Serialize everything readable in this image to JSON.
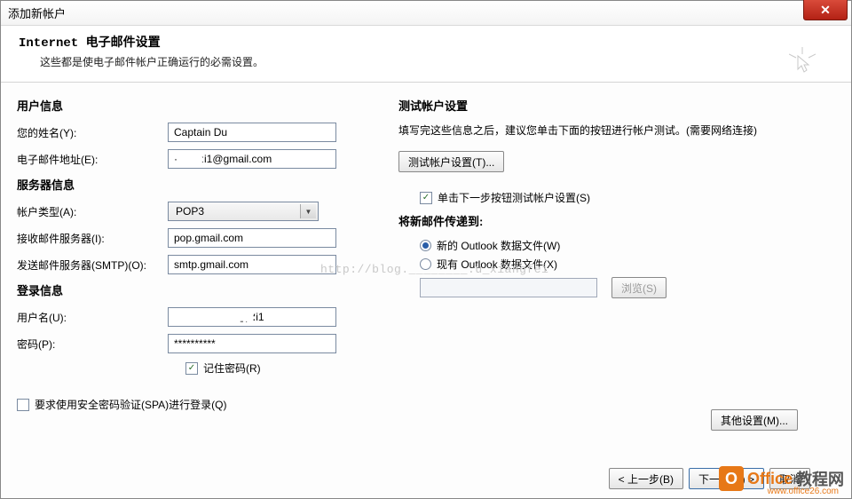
{
  "window": {
    "title": "添加新帐户"
  },
  "header": {
    "title": "Internet 电子邮件设置",
    "description": "这些都是使电子邮件帐户正确运行的必需设置。"
  },
  "left": {
    "user_info_title": "用户信息",
    "name_label": "您的姓名(Y):",
    "name_value": "Captain Du",
    "email_label": "电子邮件地址(E):",
    "email_value": "·        ːi1@gmail.com",
    "server_info_title": "服务器信息",
    "account_type_label": "帐户类型(A):",
    "account_type_value": "POP3",
    "incoming_label": "接收邮件服务器(I):",
    "incoming_value": "pop.gmail.com",
    "outgoing_label": "发送邮件服务器(SMTP)(O):",
    "outgoing_value": "smtp.gmail.com",
    "login_info_title": "登录信息",
    "username_label": "用户名(U):",
    "username_value": "ˍ  ִ ؛i1",
    "password_label": "密码(P):",
    "password_value": "**********",
    "remember_pw_label": "记住密码(R)",
    "spa_label": "要求使用安全密码验证(SPA)进行登录(Q)"
  },
  "right": {
    "test_title": "测试帐户设置",
    "test_desc": "填写完这些信息之后，建议您单击下面的按钮进行帐户测试。(需要网络连接)",
    "test_btn": "测试帐户设置(T)...",
    "test_next_chk": "单击下一步按钮测试帐户设置(S)",
    "deliver_title": "将新邮件传递到:",
    "radio_new": "新的 Outlook 数据文件(W)",
    "radio_existing": "现有 Outlook 数据文件(X)",
    "browse_btn": "浏览(S)",
    "more_settings_btn": "其他设置(M)..."
  },
  "footer": {
    "back": "< 上一步(B)",
    "next": "下一步(N) >",
    "cancel": "取消"
  },
  "watermark": {
    "text": "http://blog.________.u_xiangfei",
    "logo1": "Office",
    "logo2": "教程网",
    "url": "www.office26.com"
  }
}
